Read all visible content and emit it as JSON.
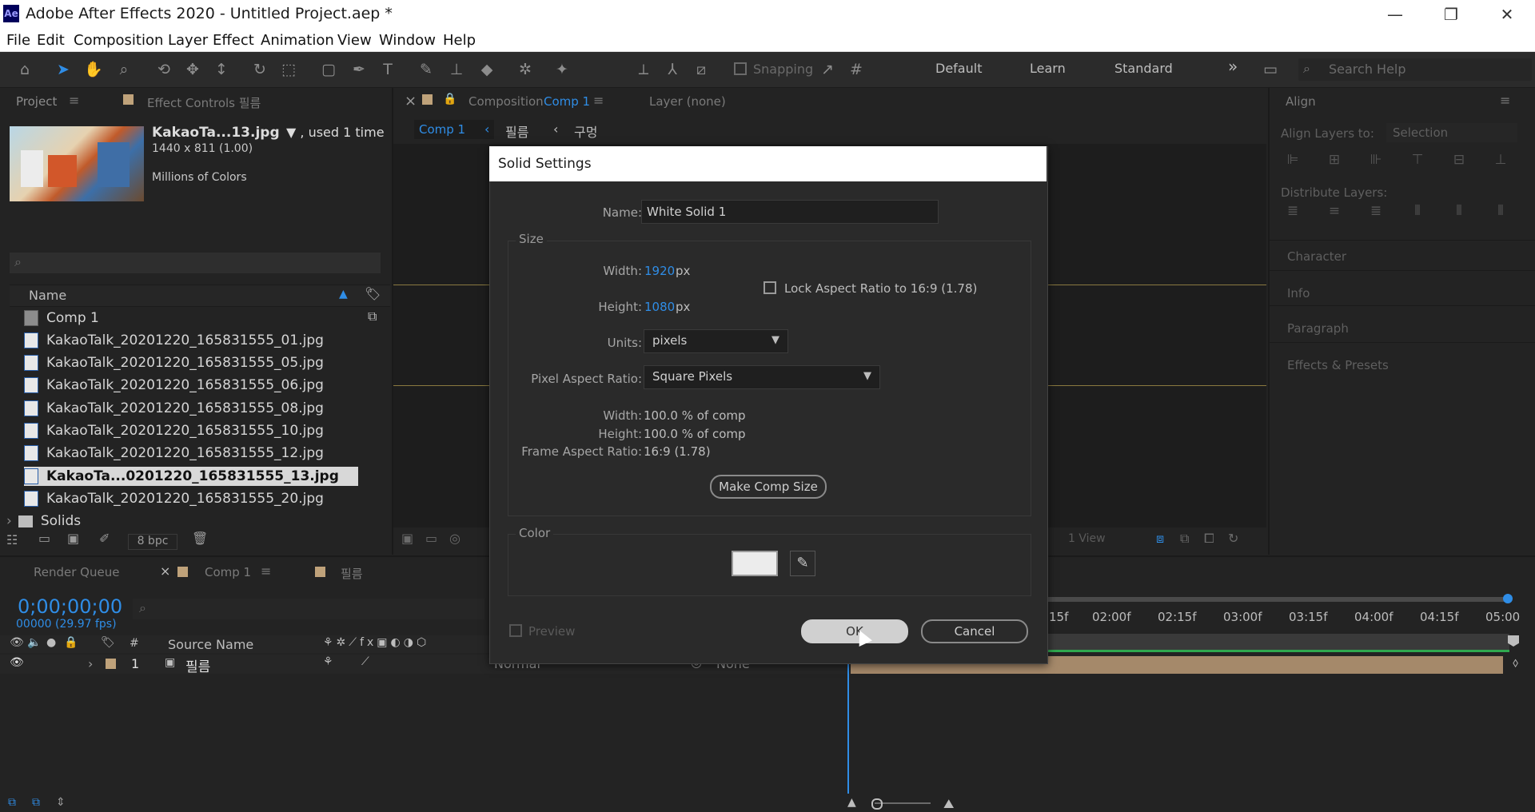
{
  "window": {
    "app_icon": "Ae",
    "title": "Adobe After Effects 2020 - Untitled Project.aep *",
    "minimize": "—",
    "restore": "❐",
    "close": "✕"
  },
  "menu": [
    "File",
    "Edit",
    "Composition",
    "Layer",
    "Effect",
    "Animation",
    "View",
    "Window",
    "Help"
  ],
  "toolbar": {
    "snapping_label": "Snapping",
    "workspaces": [
      "Default",
      "Learn",
      "Standard"
    ],
    "more": "»",
    "search_placeholder": "Search Help"
  },
  "project_panel": {
    "tab_project": "Project",
    "tab_effect_controls": "Effect Controls 필름",
    "selected_file": "KakaoTa...13.jpg",
    "used": "▼ , used 1 time",
    "dimensions": "1440 x 811 (1.00)",
    "colors": "Millions of Colors",
    "search_icon": "⌕",
    "name_column": "Name",
    "items": [
      {
        "label": "Comp 1",
        "type": "comp"
      },
      {
        "label": "KakaoTalk_20201220_165831555_01.jpg",
        "type": "image"
      },
      {
        "label": "KakaoTalk_20201220_165831555_05.jpg",
        "type": "image"
      },
      {
        "label": "KakaoTalk_20201220_165831555_06.jpg",
        "type": "image"
      },
      {
        "label": "KakaoTalk_20201220_165831555_08.jpg",
        "type": "image"
      },
      {
        "label": "KakaoTalk_20201220_165831555_10.jpg",
        "type": "image"
      },
      {
        "label": "KakaoTalk_20201220_165831555_12.jpg",
        "type": "image"
      },
      {
        "label": "KakaoTa...0201220_165831555_13.jpg",
        "type": "image",
        "selected": true
      },
      {
        "label": "KakaoTalk_20201220_165831555_20.jpg",
        "type": "image"
      },
      {
        "label": "Solids",
        "type": "folder"
      }
    ],
    "bpc": "8 bpc"
  },
  "comp_panel": {
    "close": "×",
    "tab_composition": "Composition",
    "tab_comp_name": "Comp 1",
    "tab_layer": "Layer (none)",
    "breadcrumbs": [
      "Comp 1",
      "필름",
      "구멍"
    ],
    "views": "1 View"
  },
  "align_panel": {
    "title": "Align",
    "align_layers_to": "Align Layers to:",
    "align_target": "Selection",
    "distribute": "Distribute Layers:",
    "sections": [
      "Character",
      "Info",
      "Paragraph",
      "Effects & Presets"
    ]
  },
  "timeline": {
    "tab_render_queue": "Render Queue",
    "tab_comp": "Comp 1",
    "tab_film": "필름",
    "timecode": "0;00;00;00",
    "fps": "00000 (29.97 fps)",
    "source_name_header": "Source Name",
    "hash": "#",
    "layer_number": "1",
    "layer_name": "필름",
    "mode": "Normal",
    "trkmat": "None",
    "ruler": [
      "15f",
      "02:00f",
      "02:15f",
      "03:00f",
      "03:15f",
      "04:00f",
      "04:15f",
      "05:00"
    ]
  },
  "dialog": {
    "title": "Solid Settings",
    "name_label": "Name:",
    "name_value": "White Solid 1",
    "size_group": "Size",
    "width_label": "Width:",
    "width_value": "1920",
    "height_label": "Height:",
    "height_value": "1080",
    "px": "px",
    "lock_aspect": "Lock Aspect Ratio to 16:9 (1.78)",
    "units_label": "Units:",
    "units_value": "pixels",
    "par_label": "Pixel Aspect Ratio:",
    "par_value": "Square Pixels",
    "pct_width_label": "Width:",
    "pct_width_value": "100.0 % of comp",
    "pct_height_label": "Height:",
    "pct_height_value": "100.0 % of comp",
    "far_label": "Frame Aspect Ratio:",
    "far_value": "16:9 (1.78)",
    "make_comp_size": "Make Comp Size",
    "color_group": "Color",
    "color_value": "#ececec",
    "preview": "Preview",
    "ok": "OK",
    "cancel": "Cancel"
  }
}
